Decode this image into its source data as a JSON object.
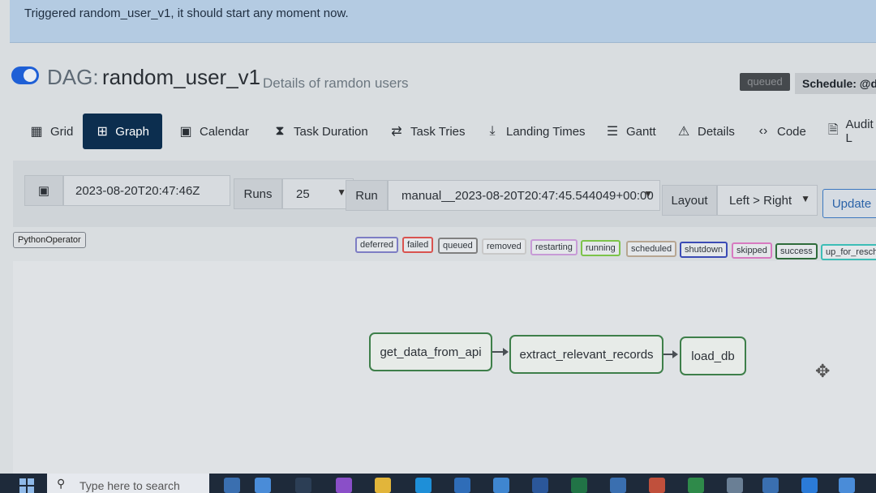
{
  "banner": {
    "message": "Triggered random_user_v1, it should start any moment now."
  },
  "dag": {
    "prefix": "DAG:",
    "dag_id": "random_user_v1",
    "description": "Details of ramdon users",
    "status_badge": "queued",
    "schedule": "Schedule: @da"
  },
  "tabs": [
    {
      "label": "Grid",
      "icon": "grid-icon"
    },
    {
      "label": "Graph",
      "icon": "graph-icon",
      "active": true
    },
    {
      "label": "Calendar",
      "icon": "calendar-icon"
    },
    {
      "label": "Task Duration",
      "icon": "hourglass-icon"
    },
    {
      "label": "Task Tries",
      "icon": "retry-icon"
    },
    {
      "label": "Landing Times",
      "icon": "landing-icon"
    },
    {
      "label": "Gantt",
      "icon": "gantt-icon"
    },
    {
      "label": "Details",
      "icon": "warning-icon"
    },
    {
      "label": "Code",
      "icon": "code-icon"
    },
    {
      "label": "Audit L",
      "icon": "audit-icon"
    }
  ],
  "filters": {
    "base_date": "2023-08-20T20:47:46Z",
    "runs_label": "Runs",
    "runs_value": "25",
    "run_label": "Run",
    "run_value": "manual__2023-08-20T20:47:45.544049+00:00",
    "layout_label": "Layout",
    "layout_value": "Left > Right",
    "update_label": "Update"
  },
  "operator": "PythonOperator",
  "states": [
    {
      "label": "deferred",
      "color": "#7d7dc4"
    },
    {
      "label": "failed",
      "color": "#d9534f"
    },
    {
      "label": "queued",
      "color": "#808080"
    },
    {
      "label": "removed",
      "color": "#c8c8c8"
    },
    {
      "label": "restarting",
      "color": "#c79bd6"
    },
    {
      "label": "running",
      "color": "#7cc34a"
    },
    {
      "label": "scheduled",
      "color": "#b7a692"
    },
    {
      "label": "shutdown",
      "color": "#3b4bb5"
    },
    {
      "label": "skipped",
      "color": "#d77ac0"
    },
    {
      "label": "success",
      "color": "#2e6b3a"
    },
    {
      "label": "up_for_resche",
      "color": "#3dbdb6"
    }
  ],
  "tasks": [
    "get_data_from_api",
    "extract_relevant_records",
    "load_db"
  ],
  "taskbar": {
    "search_placeholder": "Type here to search"
  },
  "colors": {
    "banner": "#b4cbe2",
    "active_tab": "#0c2e4f",
    "node_border": "#3e7f4a"
  }
}
